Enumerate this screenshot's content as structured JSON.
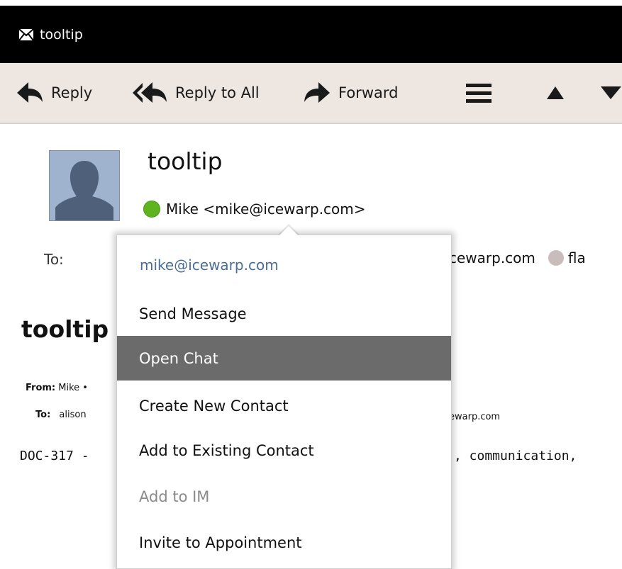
{
  "window": {
    "title": "tooltip",
    "icon": "envelope-icon"
  },
  "toolbar": {
    "reply_label": "Reply",
    "reply_all_label": "Reply to All",
    "forward_label": "Forward",
    "menu_icon": "hamburger-menu-icon",
    "up_icon": "arrow-up-icon",
    "down_icon": "arrow-down-icon"
  },
  "message": {
    "subject": "tooltip",
    "sender": "Mike <mike@icewarp.com>",
    "to_label": "To:",
    "to_partial_1": "cewarp.com",
    "to_partial_2": "fla",
    "body_title": "tooltip",
    "from_label": "From:",
    "from_value": "Mike •",
    "to_label_small": "To:",
    "to_value_small": "alison",
    "to_value_small_right": "ewarp.com",
    "body_left": "DOC-317 -",
    "body_right": ", communication,"
  },
  "popup": {
    "email": "mike@icewarp.com",
    "items": [
      {
        "label": "Send Message",
        "state": "normal"
      },
      {
        "label": "Open Chat",
        "state": "hover"
      },
      {
        "label": "Create New Contact",
        "state": "normal"
      },
      {
        "label": "Add to Existing Contact",
        "state": "normal"
      },
      {
        "label": "Add to IM",
        "state": "disabled"
      },
      {
        "label": "Invite to Appointment",
        "state": "normal"
      }
    ]
  },
  "colors": {
    "titlebar_bg": "#000000",
    "toolbar_bg": "#ede6e1",
    "status_online": "#5fb31f",
    "status_offline": "#c9bcbc",
    "email_link": "#4a6d9a",
    "menu_hover_bg": "#6b6b6b"
  }
}
